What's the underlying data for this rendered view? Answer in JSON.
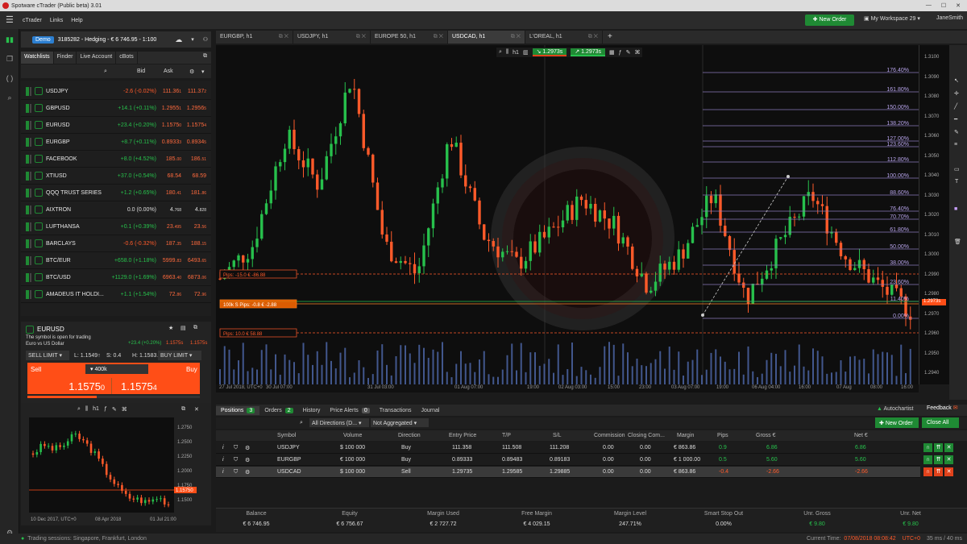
{
  "titlebar": {
    "title": "Spotware cTrader (Public beta) 3.01"
  },
  "menu": {
    "items": [
      "cTrader",
      "Links",
      "Help"
    ],
    "new_order": "New Order",
    "workspace": "My Workspace 29",
    "user": "JaneSmith"
  },
  "account": {
    "mode": "Demo",
    "info": "3185282 - Hedging - € 6 746.95 - 1:100"
  },
  "watchlist_tabs": [
    "Watchlists",
    "Finder",
    "Live Account",
    "cBots"
  ],
  "watchlist_head": {
    "bid": "Bid",
    "ask": "Ask"
  },
  "watchlist": [
    {
      "sym": "USDJPY",
      "chg": "-2.6 (-0.02%)",
      "bid": "111.36",
      "bidSub": "1",
      "ask": "111.37",
      "askSub": "2",
      "dir": "r"
    },
    {
      "sym": "GBPUSD",
      "chg": "+14.1 (+0.11%)",
      "bid": "1.2955",
      "bidSub": "1",
      "ask": "1.2956",
      "askSub": "5",
      "dir": "g"
    },
    {
      "sym": "EURUSD",
      "chg": "+23.4 (+0.20%)",
      "bid": "1.1575",
      "bidSub": "0",
      "ask": "1.1575",
      "askSub": "4",
      "dir": "g"
    },
    {
      "sym": "EURGBP",
      "chg": "+8.7 (+0.11%)",
      "bid": "0.8933",
      "bidSub": "3",
      "ask": "0.8934",
      "askSub": "5",
      "dir": "g"
    },
    {
      "sym": "FACEBOOK",
      "chg": "+8.0 (+4.52%)",
      "bid": "185.",
      "bidSub": "00",
      "ask": "186.",
      "askSub": "51",
      "dir": "g"
    },
    {
      "sym": "XTIUSD",
      "chg": "+37.0 (+0.54%)",
      "bid": "68.54",
      "bidSub": "",
      "ask": "68.59",
      "askSub": "",
      "dir": "g"
    },
    {
      "sym": "QQQ TRUST SERIES",
      "chg": "+1.2 (+0.65%)",
      "bid": "180.",
      "bidSub": "41",
      "ask": "181.",
      "askSub": "86",
      "dir": "g"
    },
    {
      "sym": "AIXTRON",
      "chg": "0.0 (0.00%)",
      "bid": "4.",
      "bidSub": "768",
      "ask": "4.",
      "askSub": "828",
      "dir": "n"
    },
    {
      "sym": "LUFTHANSA",
      "chg": "+0.1 (+0.39%)",
      "bid": "23.",
      "bidSub": "495",
      "ask": "23.",
      "askSub": "56",
      "dir": "g"
    },
    {
      "sym": "BARCLAYS",
      "chg": "-0.6 (-0.32%)",
      "bid": "187.",
      "bidSub": "35",
      "ask": "188.",
      "askSub": "15",
      "dir": "r"
    },
    {
      "sym": "BTC/EUR",
      "chg": "+658.0 (+1.18%)",
      "bid": "5999.",
      "bidSub": "83",
      "ask": "6493.",
      "askSub": "65",
      "dir": "g"
    },
    {
      "sym": "BTC/USD",
      "chg": "+1129.0 (+1.69%)",
      "bid": "6963.",
      "bidSub": "40",
      "ask": "6873.",
      "askSub": "06",
      "dir": "g"
    },
    {
      "sym": "AMADEUS IT HOLDI...",
      "chg": "+1.1 (+1.54%)",
      "bid": "72.",
      "bidSub": "86",
      "ask": "72.",
      "askSub": "96",
      "dir": "g"
    }
  ],
  "symcard": {
    "symbol": "EURUSD",
    "status": "The symbol is open for trading",
    "desc": "Euro vs US Dollar",
    "chg": "+23.4 (+0.20%)",
    "bid": "1.1575s",
    "ask": "1.1575s",
    "sell_limit": "SELL LIMIT",
    "l": "L: 1.1549↑",
    "s": "S: 0.4",
    "h": "H: 1.1583↓",
    "buy_limit": "BUY LIMIT",
    "sell": "Sell",
    "buy": "Buy",
    "volume": "400k",
    "sell_price": "1.1575",
    "sell_sub": "0",
    "buy_price": "1.1575",
    "buy_sub": "4"
  },
  "minichart": {
    "prices": [
      "1.2750",
      "1.2500",
      "1.2250",
      "1.2000",
      "1.1750",
      "1.1500"
    ],
    "tag": "1.15750",
    "dates": [
      "10 Dec 2017, UTC+0",
      "08 Apr 2018",
      "01 Jul 21:00"
    ],
    "last": "1.15750"
  },
  "chart_tabs": [
    "EURGBP, h1",
    "USDJPY, h1",
    "EUROPE 50, h1",
    "USDCAD, h1",
    "L'OREAL, h1"
  ],
  "chart_toolbar": {
    "sell": "1.2973s",
    "buy": "1.2973s"
  },
  "fib_levels": [
    "176.40%",
    "161.80%",
    "150.00%",
    "138.20%",
    "127.00%",
    "123.60%",
    "112.80%",
    "100.00%",
    "88.60%",
    "76.40%",
    "70.70%",
    "61.80%",
    "50.00%",
    "38.00%",
    "23.60%",
    "11.40%",
    "0.00%"
  ],
  "price_axis": [
    "1.3100",
    "1.3090",
    "1.3080",
    "1.3070",
    "1.3060",
    "1.3050",
    "1.3040",
    "1.3030",
    "1.3020",
    "1.3010",
    "1.3000",
    "1.2990",
    "1.2980",
    "1.2970",
    "1.2960",
    "1.2950",
    "1.2940"
  ],
  "time_axis": [
    "27 Jul 2018, UTC+0",
    "30 Jul 07:00",
    "31 Jul 03:00",
    "01 Aug 07:00",
    "19:00",
    "02 Aug 03:00",
    "15:00",
    "23:00",
    "03 Aug 07:00",
    "19:00",
    "06 Aug 04:00",
    "16:00",
    "07 Aug",
    "08:00",
    "16:00"
  ],
  "chart_labels": {
    "sl": "Pips: -15.0  € -86.88",
    "entry": "100k S  Pips: -0.8  € -2.88",
    "tp": "Pips: 10.0  € 58.88"
  },
  "bottom_tabs": [
    {
      "label": "Positions",
      "count": "3"
    },
    {
      "label": "Orders",
      "count": "2"
    },
    {
      "label": "History",
      "count": ""
    },
    {
      "label": "Price Alerts",
      "count": "0"
    },
    {
      "label": "Transactions",
      "count": ""
    },
    {
      "label": "Journal",
      "count": ""
    }
  ],
  "autochartist": "Autochartist",
  "feedback": "Feedback",
  "filters": {
    "directions": "All Directions (D...",
    "aggregation": "Not Aggregated"
  },
  "buttons": {
    "new_order": "New Order",
    "close_all": "Close All"
  },
  "positions_header": [
    "Symbol",
    "Volume",
    "Direction",
    "Entry Price",
    "T/P",
    "S/L",
    "Commission",
    "Closing Com...",
    "Margin",
    "Pips",
    "Gross €",
    "Net €"
  ],
  "positions": [
    {
      "sym": "USDJPY",
      "vol": "$ 100 000",
      "dir": "Buy",
      "entry": "111.358",
      "tp": "111.508",
      "sl": "111.208",
      "comm": "0.00",
      "ccomm": "0.00",
      "margin": "€ 863.86",
      "pips": "0.9",
      "gross": "6.86",
      "net": "6.86",
      "cls": "g"
    },
    {
      "sym": "EURGBP",
      "vol": "€ 100 000",
      "dir": "Buy",
      "entry": "0.89333",
      "tp": "0.89483",
      "sl": "0.89183",
      "comm": "0.00",
      "ccomm": "0.00",
      "margin": "€ 1 000.00",
      "pips": "0.5",
      "gross": "5.60",
      "net": "5.60",
      "cls": "g"
    },
    {
      "sym": "USDCAD",
      "vol": "$ 100 000",
      "dir": "Sell",
      "entry": "1.29735",
      "tp": "1.29585",
      "sl": "1.29885",
      "comm": "0.00",
      "ccomm": "0.00",
      "margin": "€ 863.86",
      "pips": "-0.4",
      "gross": "-2.66",
      "net": "-2.66",
      "cls": "r"
    }
  ],
  "summary": [
    {
      "label": "Balance",
      "value": "€ 6 746.95"
    },
    {
      "label": "Equity",
      "value": "€ 6 756.67"
    },
    {
      "label": "Margin Used",
      "value": "€ 2 727.72"
    },
    {
      "label": "Free Margin",
      "value": "€ 4 029.15"
    },
    {
      "label": "Margin Level",
      "value": "247.71%"
    },
    {
      "label": "Smart Stop Out",
      "value": "0.00%"
    },
    {
      "label": "Unr. Gross",
      "value": "€ 9.80"
    },
    {
      "label": "Unr. Net",
      "value": "€ 9.80"
    }
  ],
  "status": {
    "sessions": "Trading sessions:  Singapore, Frankfurt, London",
    "time_label": "Current Time:",
    "time": "07/08/2018 08:08:42",
    "tz": "UTC+0",
    "latency": "35 ms / 40 ms"
  },
  "colors": {
    "up": "#27c04c",
    "down": "#ff5a2a",
    "accent": "#1f8a34",
    "sell": "#ff4e17"
  }
}
